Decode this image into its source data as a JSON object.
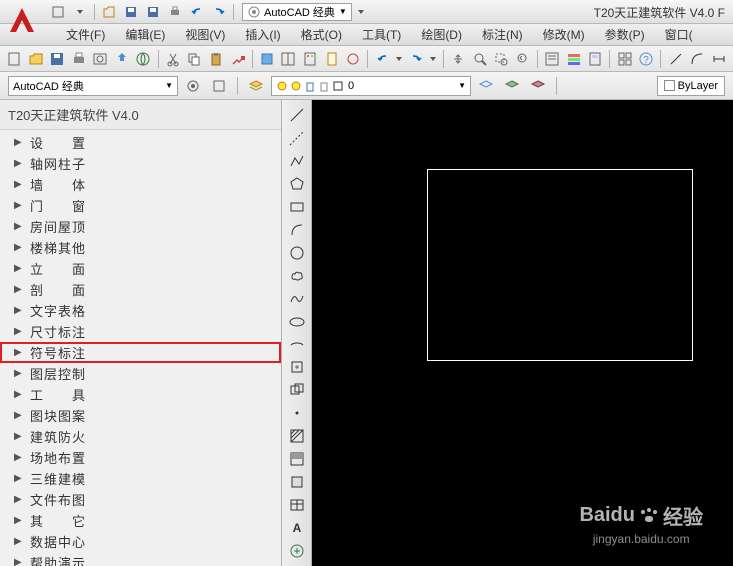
{
  "title": "T20天正建筑软件 V4.0 F",
  "workspace": "AutoCAD 经典",
  "menus": [
    "文件(F)",
    "编辑(E)",
    "视图(V)",
    "插入(I)",
    "格式(O)",
    "工具(T)",
    "绘图(D)",
    "标注(N)",
    "修改(M)",
    "参数(P)",
    "窗口("
  ],
  "layer_combo": "0",
  "bylayer": "ByLayer",
  "sidebar_title": "T20天正建筑软件 V4.0",
  "tree_items": [
    {
      "label": "设　　置",
      "hl": false
    },
    {
      "label": "轴网柱子",
      "hl": false
    },
    {
      "label": "墙　　体",
      "hl": false
    },
    {
      "label": "门　　窗",
      "hl": false
    },
    {
      "label": "房间屋顶",
      "hl": false
    },
    {
      "label": "楼梯其他",
      "hl": false
    },
    {
      "label": "立　　面",
      "hl": false
    },
    {
      "label": "剖　　面",
      "hl": false
    },
    {
      "label": "文字表格",
      "hl": false
    },
    {
      "label": "尺寸标注",
      "hl": false
    },
    {
      "label": "符号标注",
      "hl": true
    },
    {
      "label": "图层控制",
      "hl": false
    },
    {
      "label": "工　　具",
      "hl": false
    },
    {
      "label": "图块图案",
      "hl": false
    },
    {
      "label": "建筑防火",
      "hl": false
    },
    {
      "label": "场地布置",
      "hl": false
    },
    {
      "label": "三维建模",
      "hl": false
    },
    {
      "label": "文件布图",
      "hl": false
    },
    {
      "label": "其　　它",
      "hl": false
    },
    {
      "label": "数据中心",
      "hl": false
    },
    {
      "label": "帮助演示",
      "hl": false
    }
  ],
  "watermark": {
    "brand": "Baidu",
    "sub": "经验",
    "url": "jingyan.baidu.com"
  }
}
